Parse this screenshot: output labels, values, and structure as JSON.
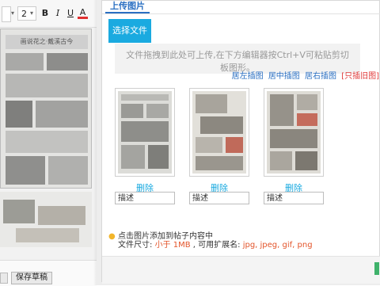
{
  "editor": {
    "toolbar": {
      "size_value": "2",
      "bold_label": "B",
      "italic_label": "I",
      "underline_label": "U",
      "color_label": "A",
      "color_bar": "#e03030"
    },
    "poster_title": "画说花之·戴溪古今",
    "footer": {
      "save_draft_label": "保存草稿"
    }
  },
  "dialog": {
    "tab_label": "上传图片",
    "choose_file_label": "选择文件",
    "drop_hint": "文件拖拽到此处可上传,在下方编辑器按Ctrl+V可粘贴剪切板图形。",
    "insert_links": {
      "left": "居左插图",
      "center": "居中插图",
      "right": "居右插图",
      "old": "[只插旧图]"
    },
    "images": [
      {
        "delete_label": "删除",
        "desc_placeholder": "描述"
      },
      {
        "delete_label": "删除",
        "desc_placeholder": "描述"
      },
      {
        "delete_label": "删除",
        "desc_placeholder": "描述"
      }
    ],
    "tips": {
      "line1": "点击图片添加到帖子内容中",
      "size_prefix": "文件尺寸: ",
      "size_value": "小于 1MB",
      "ext_prefix": " , 可用扩展名: ",
      "ext_value": "jpg, jpeg, gif, png"
    },
    "colors": {
      "accent": "#1aaae0",
      "link": "#2a6fc2",
      "warn": "#e3542a",
      "ok": "#3fb26b"
    }
  }
}
